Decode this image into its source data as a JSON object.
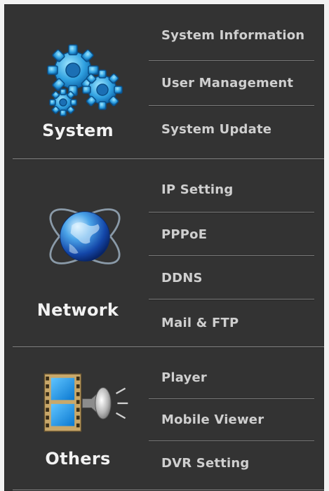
{
  "sections": [
    {
      "label": "System",
      "icon": "gears-icon",
      "items": [
        {
          "label": "System Information"
        },
        {
          "label": "User Management"
        },
        {
          "label": "System Update"
        }
      ]
    },
    {
      "label": "Network",
      "icon": "globe-icon",
      "items": [
        {
          "label": "IP Setting"
        },
        {
          "label": "PPPoE"
        },
        {
          "label": "DDNS"
        },
        {
          "label": "Mail & FTP"
        }
      ]
    },
    {
      "label": "Others",
      "icon": "film-speaker-icon",
      "items": [
        {
          "label": "Player"
        },
        {
          "label": "Mobile Viewer"
        },
        {
          "label": "DVR Setting"
        }
      ]
    }
  ],
  "colors": {
    "panel_bg": "#333333",
    "text_primary": "#f2f2f2",
    "text_menu": "#cfcfcf",
    "accent_blue": "#2fa0e0"
  }
}
